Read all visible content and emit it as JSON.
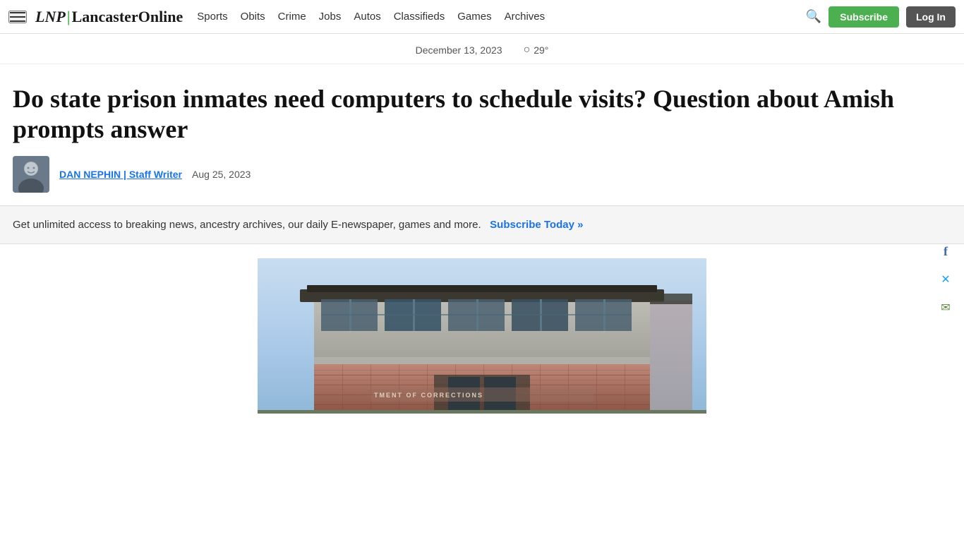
{
  "nav": {
    "hamburger_label": "menu",
    "logo_lnp": "LNP",
    "logo_pipe": "|",
    "logo_lancaster": "LancasterOnline",
    "links": [
      {
        "label": "Sports",
        "href": "#"
      },
      {
        "label": "Obits",
        "href": "#"
      },
      {
        "label": "Crime",
        "href": "#"
      },
      {
        "label": "Jobs",
        "href": "#"
      },
      {
        "label": "Autos",
        "href": "#"
      },
      {
        "label": "Classifieds",
        "href": "#"
      },
      {
        "label": "Games",
        "href": "#"
      },
      {
        "label": "Archives",
        "href": "#"
      }
    ],
    "subscribe_label": "Subscribe",
    "login_label": "Log In"
  },
  "info_bar": {
    "date": "December 13, 2023",
    "temperature": "29°"
  },
  "article": {
    "title": "Do state prison inmates need computers to schedule visits? Question about Amish prompts answer",
    "author_name": "DAN NEPHIN | Staff Writer",
    "author_date": "Aug 25, 2023"
  },
  "subscription_banner": {
    "text": "Get unlimited access to breaking news, ancestry archives, our daily E-newspaper, games and more.",
    "link_text": "Subscribe Today »",
    "link_href": "#"
  },
  "social": {
    "facebook_label": "facebook",
    "twitter_label": "twitter",
    "email_label": "email"
  }
}
